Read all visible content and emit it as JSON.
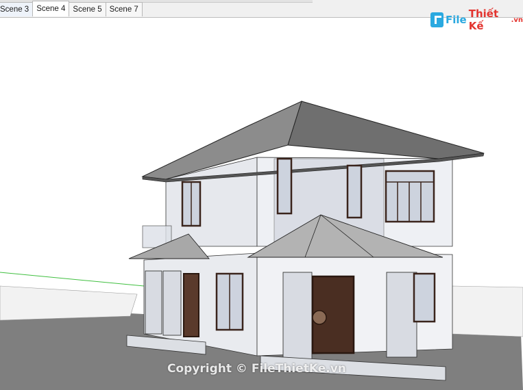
{
  "scene_tabs": [
    {
      "label": "Scene 3",
      "active": false
    },
    {
      "label": "Scene 4",
      "active": true
    },
    {
      "label": "Scene 5",
      "active": false
    },
    {
      "label": "Scene 7",
      "active": false
    }
  ],
  "watermark": {
    "logo_file": "File",
    "logo_rest": "Thiết Kế",
    "logo_domain": ".vn",
    "copyright": "Copyright © FileThietKe.vn"
  },
  "colors": {
    "ground": "#7f7f7f",
    "sky": "#ffffff",
    "roof": "#7d7d7d",
    "window_frame": "#3a241c",
    "glass": "#cdd3de",
    "green_axis": "#3fbf3f",
    "logo_blue": "#2aa9e0",
    "logo_red": "#e3342f"
  }
}
